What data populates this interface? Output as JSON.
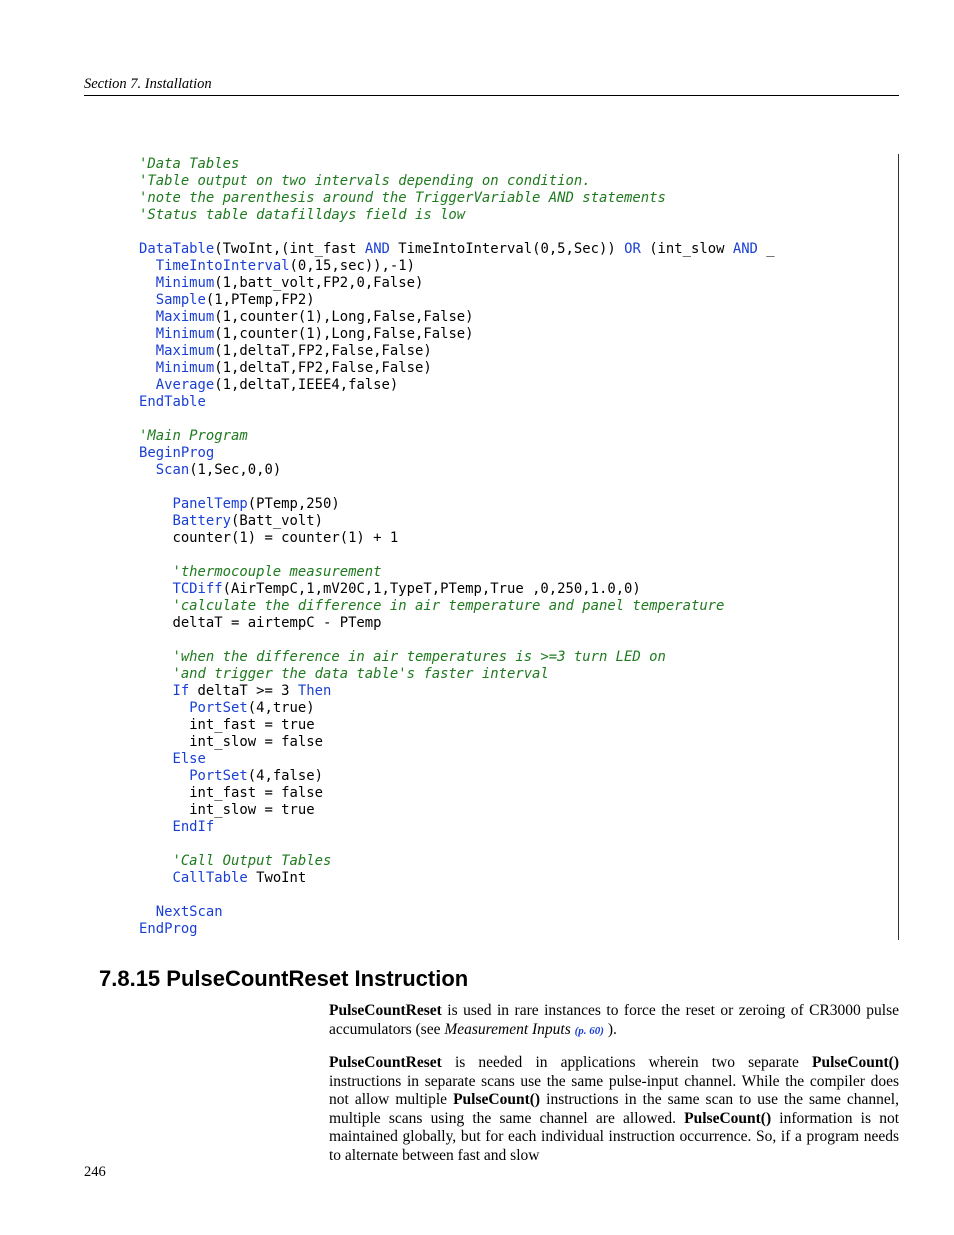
{
  "header": {
    "running": "Section 7.  Installation"
  },
  "code": {
    "line01": "'Data Tables",
    "line02": "'Table output on two intervals depending on condition.",
    "line03": "'note the parenthesis around the TriggerVariable AND statements",
    "line04": "'Status table datafilldays field is low",
    "dt_kw": "DataTable",
    "dt_args_a": "(TwoInt,(int_fast ",
    "and_kw": "AND",
    "dt_args_b": " TimeIntoInterval(0,5,Sec)) ",
    "or_kw": "OR",
    "dt_args_c": " (int_slow ",
    "and_kw2": "AND",
    "dt_args_d": " _",
    "tii_kw": "TimeIntoInterval",
    "tii_args": "(0,15,sec)),-1)",
    "min1_kw": "Minimum",
    "min1_args": "(1,batt_volt,FP2,0,False)",
    "samp_kw": "Sample",
    "samp_args": "(1,PTemp,FP2)",
    "max1_kw": "Maximum",
    "max1_args": "(1,counter(1),Long,False,False)",
    "min2_kw": "Minimum",
    "min2_args": "(1,counter(1),Long,False,False)",
    "max2_kw": "Maximum",
    "max2_args": "(1,deltaT,FP2,False,False)",
    "min3_kw": "Minimum",
    "min3_args": "(1,deltaT,FP2,False,False)",
    "avg_kw": "Average",
    "avg_args": "(1,deltaT,IEEE4,false)",
    "endtable_kw": "EndTable",
    "main_cmt": "'Main Program",
    "beginprog_kw": "BeginProg",
    "scan_kw": "Scan",
    "scan_args": "(1,Sec,0,0)",
    "panel_kw": "PanelTemp",
    "panel_args": "(PTemp,250)",
    "batt_kw": "Battery",
    "batt_args": "(Batt_volt)",
    "counter_line": "counter(1) = counter(1) + 1",
    "thermo_cmt": "'thermocouple measurement",
    "tcd_kw": "TCDiff",
    "tcd_args": "(AirTempC,1,mV20C,1,TypeT,PTemp,True ,0,250,1.0,0)",
    "calc_cmt": "'calculate the difference in air temperature and panel temperature",
    "deltaT_line": "deltaT = airtempC - PTemp",
    "when_cmt": "'when the difference in air temperatures is >=3 turn LED on",
    "when_cmt2": "'and trigger the data table's faster interval",
    "if_kw": "If",
    "if_cond": " deltaT >= 3 ",
    "then_kw": "Then",
    "ps1_kw": "PortSet",
    "ps1_args": "(4,true)",
    "if_l1": "int_fast = true",
    "if_l2": "int_slow = false",
    "else_kw": "Else",
    "ps2_kw": "PortSet",
    "ps2_args": "(4,false)",
    "el_l1": "int_fast = false",
    "el_l2": "int_slow = true",
    "endif_kw": "EndIf",
    "call_cmt": "'Call Output Tables",
    "calltable_kw": "CallTable",
    "calltable_arg": " TwoInt",
    "nextscan_kw": "NextScan",
    "endprog_kw": "EndProg"
  },
  "section": {
    "heading": "7.8.15 PulseCountReset Instruction",
    "p1": {
      "b1": "PulseCountReset",
      "t1": " is used in rare instances to force the reset or zeroing of CR3000 pulse accumulators (see ",
      "ref_label": "Measurement Inputs ",
      "ref_page": "(p. 60)",
      "t2": " )."
    },
    "p2": {
      "b1": "PulseCountReset",
      "t1": " is needed in applications wherein two separate ",
      "b2": "PulseCount()",
      "t2": " instructions in separate scans use the same pulse-input channel.  While the compiler does not allow multiple ",
      "b3": "PulseCount()",
      "t3": " instructions in the same scan to use the same channel, multiple scans using the same channel are allowed.  ",
      "b4": "PulseCount()",
      "t4": " information is not maintained globally, but for each individual instruction occurrence.  So, if a program needs to alternate between fast and slow"
    }
  },
  "page_number": "246"
}
